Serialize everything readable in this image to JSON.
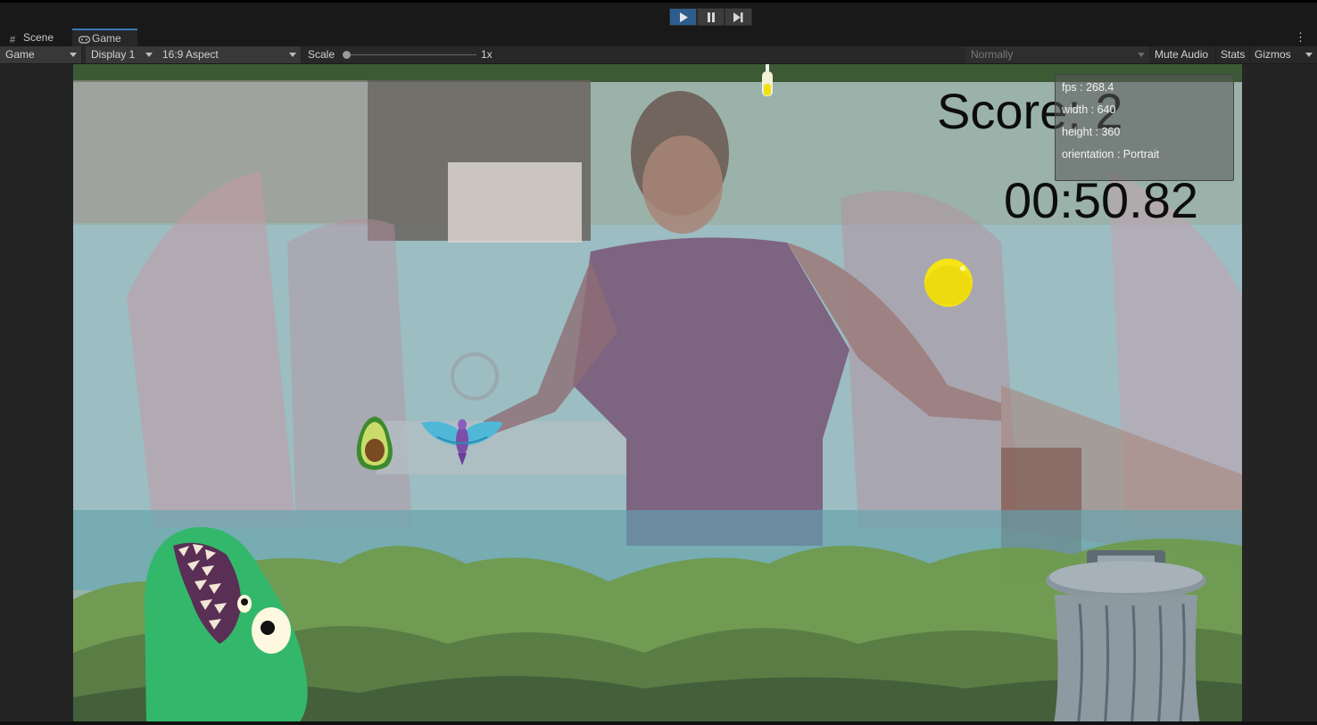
{
  "toolbar_top": {
    "controls": [
      "play-icon",
      "pause-icon",
      "step-icon"
    ]
  },
  "tabs": [
    {
      "label": "Scene",
      "icon": "grid-icon"
    },
    {
      "label": "Game",
      "icon": "gamepad-icon"
    }
  ],
  "game_toolbar": {
    "mode": "Game",
    "display": "Display 1",
    "aspect": "16:9 Aspect",
    "scale_label": "Scale",
    "scale_value": "1x",
    "play_focus": "Normally",
    "mute_audio": "Mute Audio",
    "stats": "Stats",
    "gizmos": "Gizmos"
  },
  "hud": {
    "score": "Score: 2",
    "timer": "00:50.82"
  },
  "stats_panel": {
    "fps": "fps : 268.4",
    "width": "width : 640",
    "height": "height : 360",
    "orientation": "orientation : Portrait"
  },
  "colors": {
    "accent": "#2d5d8f",
    "tab_highlight": "#3a79bb",
    "panel_bg": "#282828"
  }
}
